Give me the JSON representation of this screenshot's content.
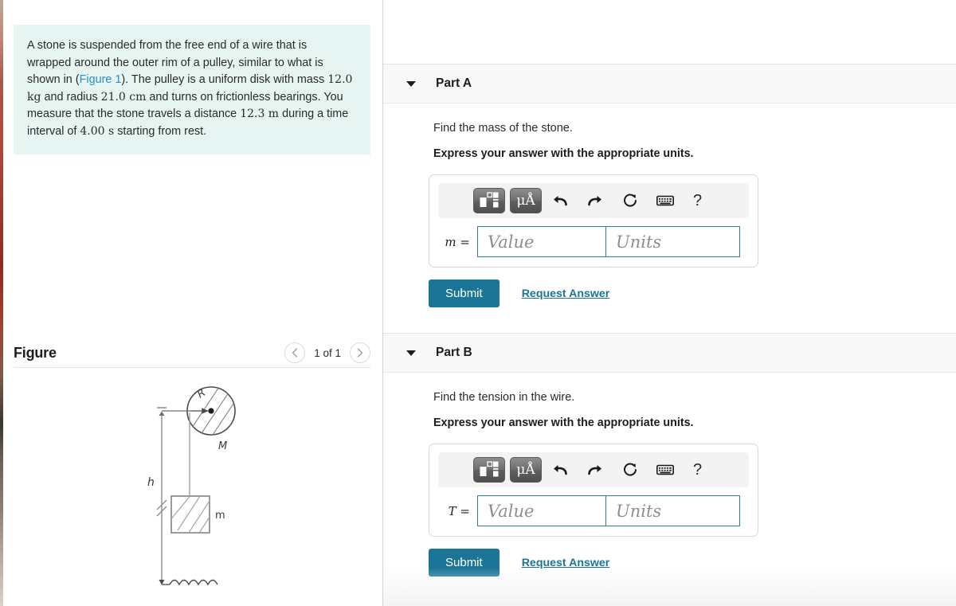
{
  "problem": {
    "text_before_link": "A stone is suspended from the free end of a wire that is wrapped around the outer rim of a pulley, similar to what is shown in (",
    "link_label": "Figure 1",
    "segment_2": "). The pulley is a uniform disk with mass ",
    "mass_value": "12.0 kg",
    "segment_3": " and radius ",
    "radius_value": "21.0 cm",
    "segment_4": " and turns on frictionless bearings. You measure that the stone travels a distance ",
    "distance_value": "12.3 m",
    "segment_5": " during a time interval of ",
    "time_value": "4.00 s",
    "segment_6": " starting from rest."
  },
  "figure": {
    "title": "Figure",
    "pager_label": "1 of 1",
    "prev_icon": "chevron-left-icon",
    "next_icon": "chevron-right-icon",
    "labels": {
      "radius": "R",
      "pulley_mass": "M",
      "height": "h",
      "block_mass": "m"
    }
  },
  "toolbar": {
    "template_icon": "math-template-icon",
    "units_icon": "units-micro-angstrom-icon",
    "units_label": "μÅ",
    "undo_icon": "undo-icon",
    "redo_icon": "redo-icon",
    "reset_icon": "reset-icon",
    "keyboard_icon": "keyboard-icon",
    "help_icon": "help-icon",
    "help_label": "?"
  },
  "parts": [
    {
      "id": "part-a",
      "title": "Part A",
      "prompt": "Find the mass of the stone.",
      "instruction": "Express your answer with the appropriate units.",
      "variable": "m",
      "equals": " =",
      "value_placeholder": "Value",
      "units_placeholder": "Units",
      "value": "",
      "units": "",
      "submit_label": "Submit",
      "request_label": "Request Answer"
    },
    {
      "id": "part-b",
      "title": "Part B",
      "prompt": "Find the tension in the wire.",
      "instruction": "Express your answer with the appropriate units.",
      "variable": "T",
      "equals": " =",
      "value_placeholder": "Value",
      "units_placeholder": "Units",
      "value": "",
      "units": "",
      "submit_label": "Submit",
      "request_label": "Request Answer"
    }
  ],
  "colors": {
    "problem_bg": "#e6f4f2",
    "link": "#2b8fc5",
    "accent": "#1a7596",
    "input_border": "#2b8196",
    "part_header_bg": "#f8f8f8"
  }
}
